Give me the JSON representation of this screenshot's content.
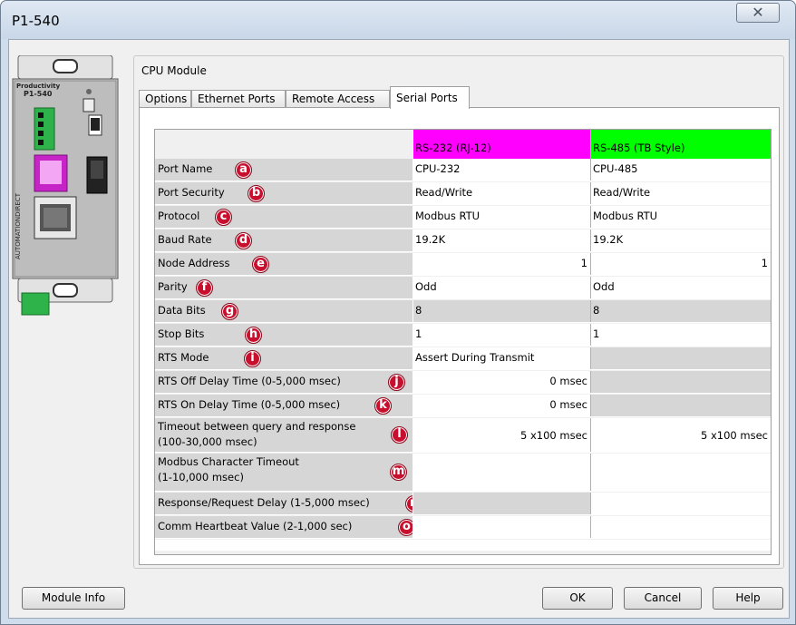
{
  "window": {
    "title": "P1-540",
    "close_glyph": "✕"
  },
  "device": {
    "brand": "Productivity",
    "model": "P1-540",
    "vendor": "AUTOMATIONDIRECT"
  },
  "group_label": "CPU Module",
  "tabs": [
    {
      "label": "Options",
      "active": false
    },
    {
      "label": "Ethernet Ports",
      "active": false
    },
    {
      "label": "Remote Access",
      "active": false
    },
    {
      "label": "Serial Ports",
      "active": true
    }
  ],
  "grid": {
    "headers": {
      "col1": "RS-232 (RJ-12)",
      "col2": "RS-485 (TB Style)"
    },
    "header_colors": {
      "col1": "#ff00ff",
      "col2": "#00ff00"
    },
    "rows": [
      {
        "label": "Port Name",
        "marker": "a",
        "v1": "CPU-232",
        "v2": "CPU-485"
      },
      {
        "label": "Port Security",
        "marker": "b",
        "v1": "Read/Write",
        "v2": "Read/Write"
      },
      {
        "label": "Protocol",
        "marker": "c",
        "v1": "Modbus RTU",
        "v2": "Modbus RTU"
      },
      {
        "label": "Baud Rate",
        "marker": "d",
        "v1": "19.2K",
        "v2": "19.2K"
      },
      {
        "label": "Node Address",
        "marker": "e",
        "v1": "1",
        "v2": "1"
      },
      {
        "label": "Parity",
        "marker": "f",
        "v1": "Odd",
        "v2": "Odd"
      },
      {
        "label": "Data Bits",
        "marker": "g",
        "v1": "8",
        "v2": "8"
      },
      {
        "label": "Stop Bits",
        "marker": "h",
        "v1": "1",
        "v2": "1"
      },
      {
        "label": "RTS Mode",
        "marker": "i",
        "v1": "Assert During Transmit",
        "v2": ""
      },
      {
        "label": "RTS Off Delay Time (0-5,000 msec)",
        "marker": "j",
        "v1": "0  msec",
        "v2": ""
      },
      {
        "label": "RTS On Delay Time (0-5,000 msec)",
        "marker": "k",
        "v1": "0  msec",
        "v2": ""
      },
      {
        "label": "Timeout between query and response",
        "label2": "(100-30,000 msec)",
        "marker": "l",
        "v1": "5  x100 msec",
        "v2": "5  x100 msec"
      },
      {
        "label": "Modbus Character Timeout",
        "label2": "(1-10,000 msec)",
        "marker": "m",
        "v1": "",
        "v2": ""
      },
      {
        "label": "Response/Request Delay (1-5,000 msec)",
        "marker": "n",
        "v1": "",
        "v2": ""
      },
      {
        "label": "Comm Heartbeat Value (2-1,000 sec)",
        "marker": "o",
        "v1": "",
        "v2": ""
      }
    ]
  },
  "buttons": {
    "module_info": "Module Info",
    "ok": "OK",
    "cancel": "Cancel",
    "help": "Help"
  }
}
